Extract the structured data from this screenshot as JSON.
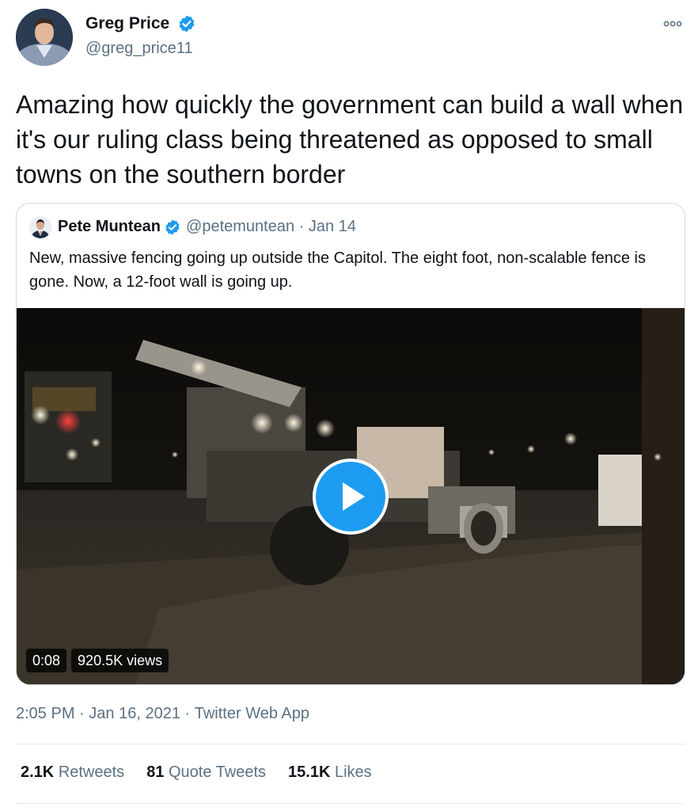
{
  "tweet": {
    "author": {
      "name": "Greg Price",
      "handle": "@greg_price11",
      "avatar_icon": "avatar-greg-price",
      "verified_icon": "verified-badge-icon"
    },
    "more_icon": "more-options-icon",
    "text": "Amazing how quickly the government can build a wall when it's our ruling class being threatened as opposed to small towns on the southern border",
    "quoted": {
      "author_name": "Pete Muntean",
      "handle": "@petemuntean",
      "separator": "·",
      "date": "Jan 14",
      "text": "New, massive fencing going up outside the Capitol. The eight foot, non-scalable fence is gone. Now, a 12-foot wall is going up.",
      "video": {
        "duration": "0:08",
        "views": "920.5K views",
        "play_icon": "play-icon"
      }
    },
    "meta": {
      "time": "2:05 PM",
      "date": "Jan 16, 2021",
      "source": "Twitter Web App",
      "separator": "·"
    },
    "stats": [
      {
        "count": "2.1K",
        "label": "Retweets"
      },
      {
        "count": "81",
        "label": "Quote Tweets"
      },
      {
        "count": "15.1K",
        "label": "Likes"
      }
    ]
  },
  "colors": {
    "accent": "#1d9bf0",
    "text": "#0f1419",
    "secondary": "#5b7083",
    "border": "#cfd9de"
  }
}
